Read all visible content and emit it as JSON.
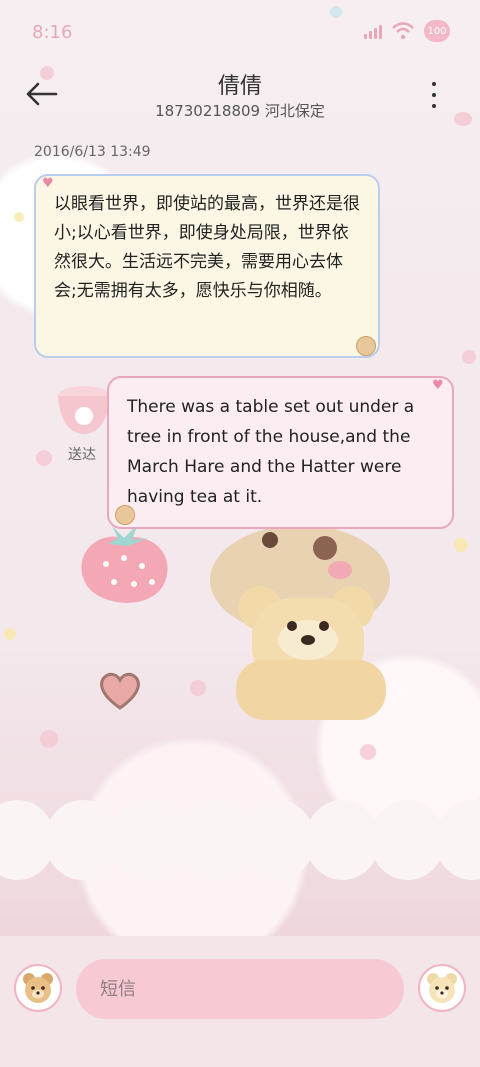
{
  "status_bar": {
    "time": "8:16",
    "battery": "100"
  },
  "header": {
    "contact_name": "倩倩",
    "contact_info": "18730218809 河北保定"
  },
  "conversation": {
    "timestamp": "2016/6/13 13:49",
    "incoming_message": "以眼看世界，即使站的最高，世界还是很小;以心看世界，即使身处局限，世界依然很大。生活远不完美，需要用心去体会;无需拥有太多，愿快乐与你相随。",
    "outgoing_message": "There was a table set out under a tree in front of the house,and the March Hare and the Hatter were having tea at it.",
    "delivery_status": "送达"
  },
  "compose": {
    "placeholder": "短信"
  },
  "colors": {
    "accent": "#e8a7b8",
    "incoming_bubble": "#fbf7e4",
    "incoming_border": "#b9cdee",
    "outgoing_bubble": "#fcedf2",
    "outgoing_border": "#e9a7bd",
    "input_bg": "#f7c9d3"
  }
}
